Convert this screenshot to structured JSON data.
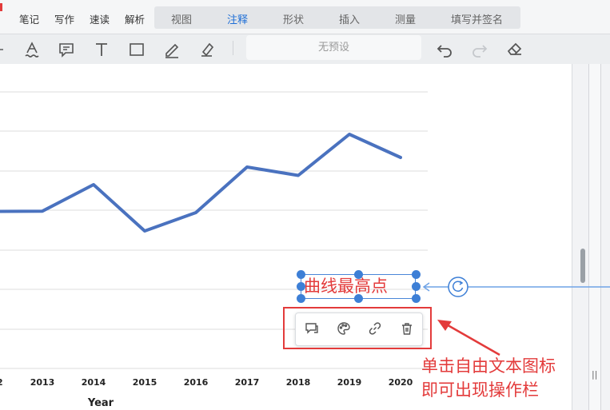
{
  "menu": {
    "items": [
      "笔记",
      "写作",
      "速读",
      "解析"
    ],
    "tabs": [
      {
        "label": "视图",
        "active": false
      },
      {
        "label": "注释",
        "active": true
      },
      {
        "label": "形状",
        "active": false
      },
      {
        "label": "插入",
        "active": false
      },
      {
        "label": "测量",
        "active": false
      },
      {
        "label": "填写并签名",
        "active": false
      }
    ]
  },
  "toolbar": {
    "tools": [
      "text-underline-icon",
      "comment-icon",
      "text-tool-icon",
      "rectangle-icon",
      "pen-icon",
      "highlighter-icon"
    ],
    "preset_placeholder": "无预设",
    "actions": [
      "undo-icon",
      "redo-icon",
      "eraser-icon"
    ]
  },
  "chart_data": {
    "type": "line",
    "x": [
      "2013",
      "2014",
      "2015",
      "2016",
      "2017",
      "2018",
      "2019",
      "2020"
    ],
    "xlabel": "Year",
    "series": [
      {
        "values": [
          184.2,
          151,
          209,
          186,
          129,
          139.5,
          88,
          117
        ],
        "color": "#4a72bf"
      }
    ],
    "partial_first_point": 184.5,
    "grid": true
  },
  "annotation": {
    "text": "曲线最高点",
    "color": "#e33b3b"
  },
  "mini_toolbar": {
    "buttons": [
      "comment-icon",
      "palette-icon",
      "link-icon",
      "delete-icon"
    ]
  },
  "callout": {
    "line1": "单击自由文本图标",
    "line2": "即可出现操作栏"
  },
  "colors": {
    "accent": "#1f6fd6",
    "annotation_red": "#e33b3b",
    "selection_blue": "#3d7fd6"
  }
}
